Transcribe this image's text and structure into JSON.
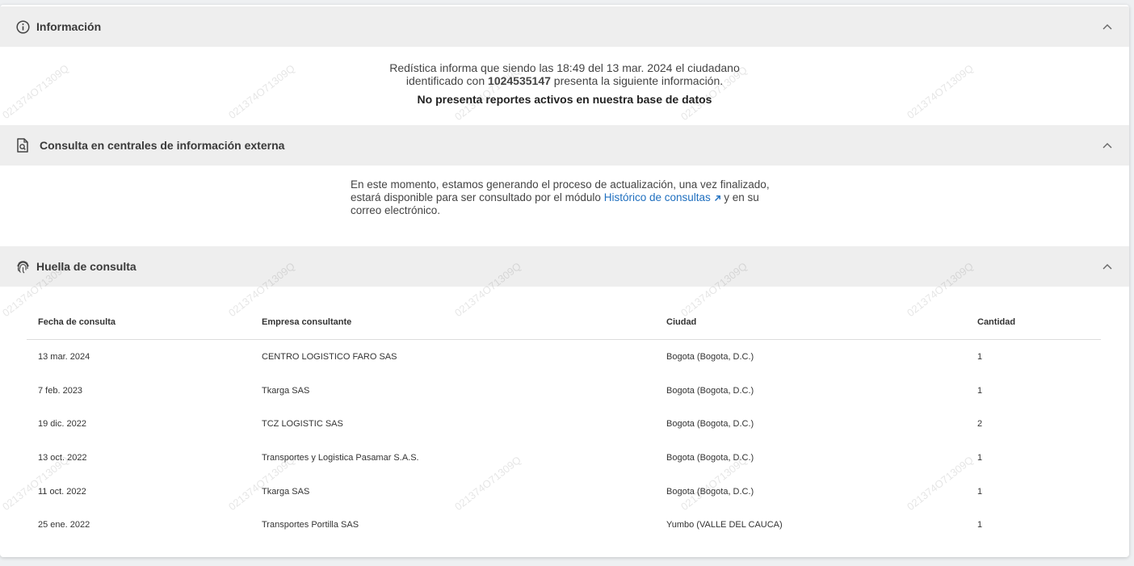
{
  "sections": {
    "informacion": {
      "title": "Información",
      "line1": "Redística informa que siendo las 18:49 del 13 mar. 2024 el ciudadano",
      "line2_prefix": "identificado con ",
      "document_id": "1024535147",
      "line2_suffix": " presenta la siguiente información.",
      "status": "No presenta reportes activos en nuestra base de datos"
    },
    "consulta_externa": {
      "title": "Consulta en centrales de información externa",
      "text_before": "En este momento, estamos generando el proceso de actualización, una vez finalizado, estará disponible para ser consultado por el módulo ",
      "link_label": "Histórico de consultas",
      "text_after": " y en su correo electrónico."
    },
    "huella": {
      "title": "Huella de consulta",
      "columns": [
        "Fecha de consulta",
        "Empresa consultante",
        "Ciudad",
        "Cantidad"
      ],
      "rows": [
        [
          "13 mar. 2024",
          "CENTRO LOGISTICO FARO SAS",
          "Bogota (Bogota, D.C.)",
          "1"
        ],
        [
          "7 feb. 2023",
          "Tkarga SAS",
          "Bogota (Bogota, D.C.)",
          "1"
        ],
        [
          "19 dic. 2022",
          "TCZ LOGISTIC SAS",
          "Bogota (Bogota, D.C.)",
          "2"
        ],
        [
          "13 oct. 2022",
          "Transportes y Logistica Pasamar S.A.S.",
          "Bogota (Bogota, D.C.)",
          "1"
        ],
        [
          "11 oct. 2022",
          "Tkarga SAS",
          "Bogota (Bogota, D.C.)",
          "1"
        ],
        [
          "25 ene. 2022",
          "Transportes Portilla SAS",
          "Yumbo (VALLE DEL CAUCA)",
          "1"
        ]
      ]
    }
  },
  "watermark_text": "021374O71309Q",
  "icons": {
    "info": "info-circle-icon",
    "document_search": "document-search-icon",
    "fingerprint": "fingerprint-icon",
    "chevron": "chevron-up-icon",
    "external_link": "external-link-arrow-icon"
  },
  "colors": {
    "header_bg": "#eeeeee",
    "link": "#1f6fbf"
  }
}
